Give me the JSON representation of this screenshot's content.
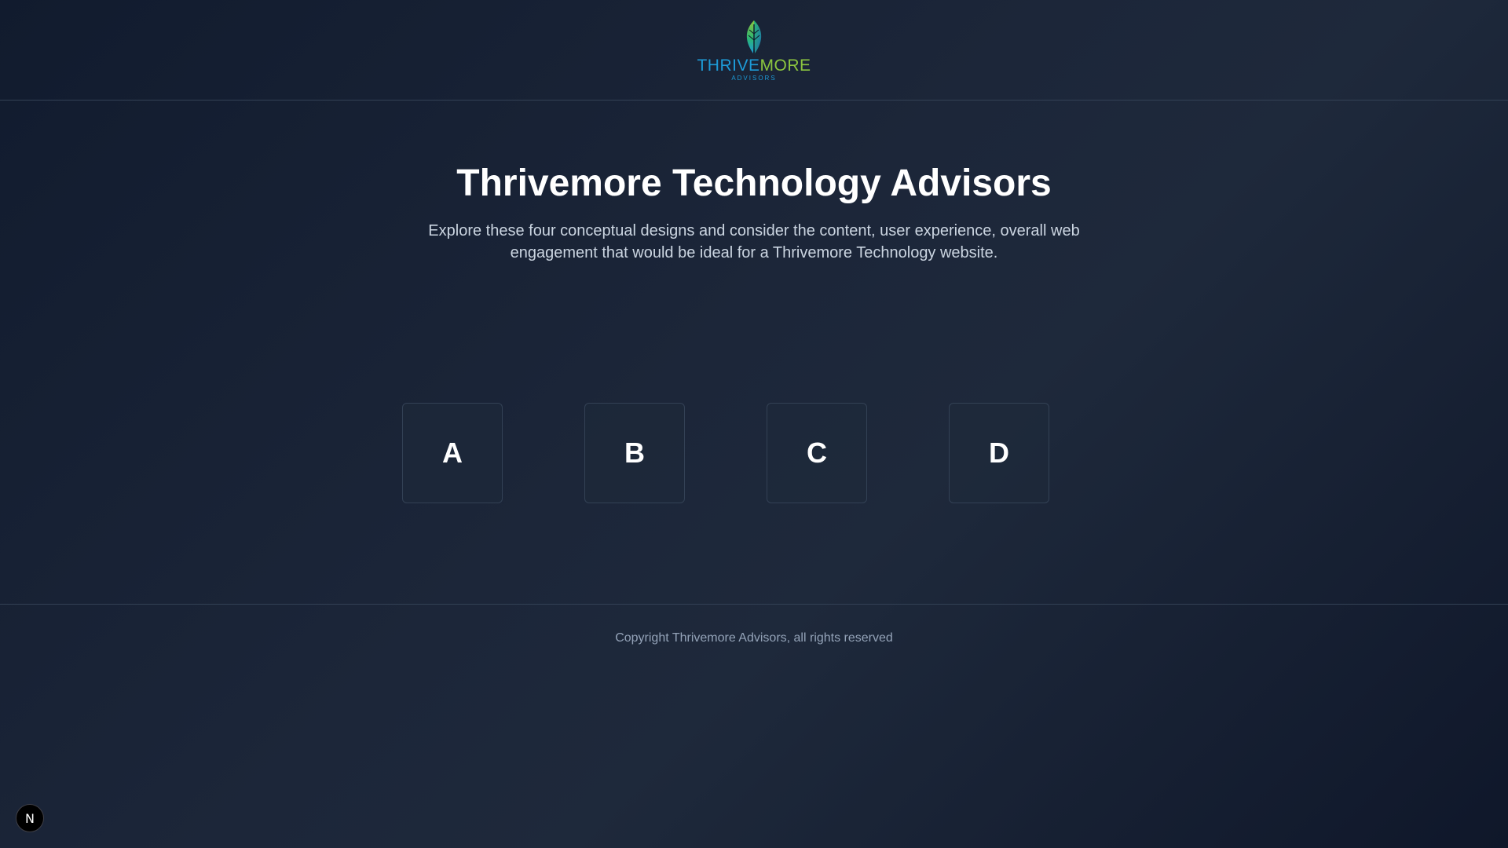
{
  "header": {
    "logo": {
      "word_part1": "THRIVE",
      "word_part2": "MORE",
      "subtitle": "ADVISORS",
      "icon": "leaf-icon",
      "colors": {
        "blue": "#1d9bd7",
        "green": "#8cc63f"
      }
    }
  },
  "hero": {
    "title": "Thrivemore Technology Advisors",
    "description": "Explore these four conceptual designs and consider the content, user experience, overall web engagement that would be ideal for a Thrivemore Technology website."
  },
  "designs": [
    {
      "label": "A"
    },
    {
      "label": "B"
    },
    {
      "label": "C"
    },
    {
      "label": "D"
    }
  ],
  "footer": {
    "copyright": "Copyright Thrivemore Advisors, all rights reserved"
  },
  "dev_badge": {
    "label": "N",
    "icon": "nextjs-icon"
  },
  "colors": {
    "background": "#1e293b",
    "border": "#334155",
    "text_muted": "#94a3b8"
  }
}
